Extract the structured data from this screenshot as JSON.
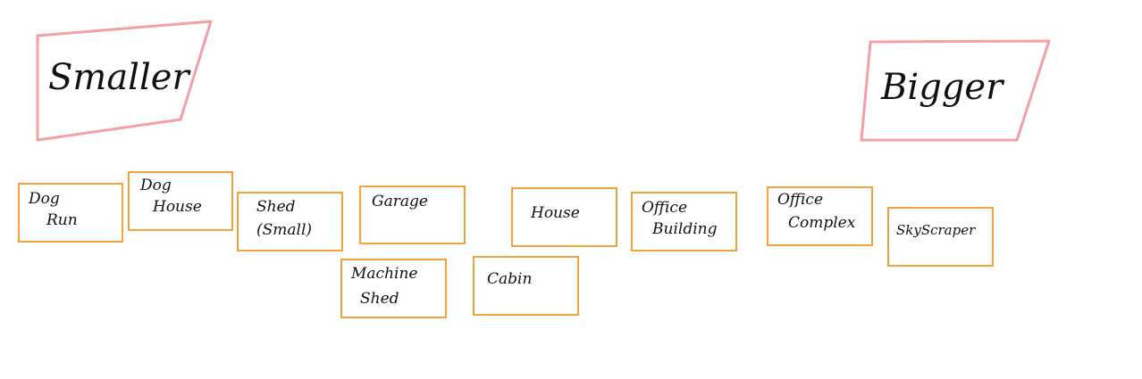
{
  "scale": {
    "smaller_label": "Smaller",
    "bigger_label": "Bigger",
    "frame_color": "#f4a0a3"
  },
  "cards": [
    {
      "id": "dog-run",
      "line1": "Dog",
      "line2": "Run"
    },
    {
      "id": "dog-house",
      "line1": "Dog",
      "line2": "House"
    },
    {
      "id": "shed-small",
      "line1": "Shed",
      "line2": "(Small)"
    },
    {
      "id": "garage",
      "line1": "Garage",
      "line2": ""
    },
    {
      "id": "machine-shed",
      "line1": "Machine",
      "line2": "Shed"
    },
    {
      "id": "cabin",
      "line1": "Cabin",
      "line2": ""
    },
    {
      "id": "house",
      "line1": "House",
      "line2": ""
    },
    {
      "id": "office-building",
      "line1": "Office",
      "line2": "Building"
    },
    {
      "id": "office-complex",
      "line1": "Office",
      "line2": "Complex"
    },
    {
      "id": "skyscraper",
      "line1": "SkyScraper",
      "line2": ""
    }
  ],
  "card_color": "#f0a43a"
}
